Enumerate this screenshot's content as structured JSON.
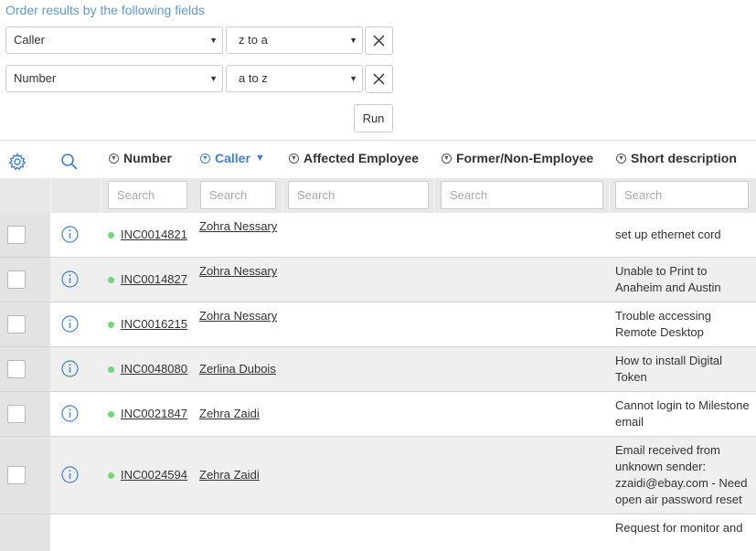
{
  "order": {
    "hint": "Order results by the following fields",
    "sorts": [
      {
        "field": "Caller",
        "direction": "z to a"
      },
      {
        "field": "Number",
        "direction": "a to z"
      }
    ],
    "run_label": "Run"
  },
  "table": {
    "columns": [
      "Number",
      "Caller",
      "Affected Employee",
      "Former/Non-Employee",
      "Short description"
    ],
    "sorted_column": "Caller",
    "sort_indicator": "▼",
    "search_placeholder": "Search",
    "rows": [
      {
        "number": "INC0014821",
        "caller": "Zohra Nessary",
        "description": "set up ethernet cord"
      },
      {
        "number": "INC0014827",
        "caller": "Zohra Nessary",
        "description": "Unable to Print to Anaheim and Austin"
      },
      {
        "number": "INC0016215",
        "caller": "Zohra Nessary",
        "description": "Trouble accessing Remote Desktop"
      },
      {
        "number": "INC0048080",
        "caller": "Zerlina Dubois",
        "description": "How to install Digital Token"
      },
      {
        "number": "INC0021847",
        "caller": "Zehra Zaidi",
        "description": "Cannot login to Milestone email"
      },
      {
        "number": "INC0024594",
        "caller": "Zehra Zaidi",
        "description": "Email received from unknown sender: zzaidi@ebay.com - Need open air password reset"
      },
      {
        "number": "",
        "caller": "",
        "description": "Request for monitor and"
      }
    ]
  },
  "icons": {
    "settings": "gear-icon",
    "search": "search-icon",
    "row_info": "info-icon",
    "remove": "close-icon",
    "status": "status-dot"
  },
  "colors": {
    "accent": "#3f80d8",
    "hint": "#5b9bd5",
    "status_dot": "#71d77a",
    "row_alt": "#efefef"
  }
}
